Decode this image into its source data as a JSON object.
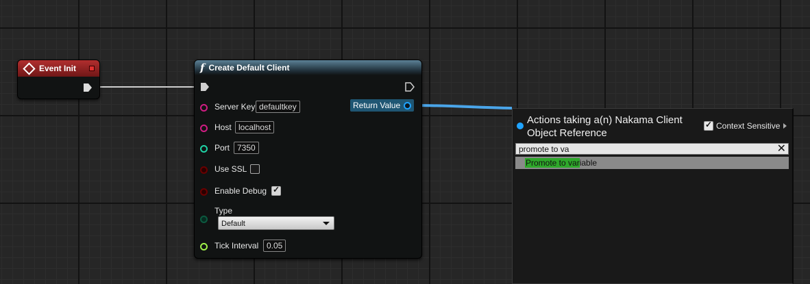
{
  "event_node": {
    "title": "Event Init"
  },
  "func_node": {
    "title": "Create Default Client",
    "glyph": "f",
    "return_label": "Return Value",
    "pins": {
      "server_key": {
        "label": "Server Key",
        "value": "defaultkey"
      },
      "host": {
        "label": "Host",
        "value": "localhost"
      },
      "port": {
        "label": "Port",
        "value": "7350"
      },
      "use_ssl": {
        "label": "Use SSL",
        "checked": false
      },
      "enable_debug": {
        "label": "Enable Debug",
        "checked": true
      },
      "type": {
        "label": "Type",
        "value": "Default"
      },
      "tick_interval": {
        "label": "Tick Interval",
        "value": "0.05"
      }
    }
  },
  "action_menu": {
    "title": "Actions taking a(n) Nakama Client Object Reference",
    "context_label": "Context Sensitive",
    "context_checked": true,
    "search_value": "promote to va",
    "results": [
      {
        "label": "Promote to variable"
      }
    ]
  },
  "colors": {
    "event_header": "#b12e2e",
    "func_header": "#5b8196",
    "object_pin": "#1fa3ff",
    "string_pin": "#d11d83",
    "int_pin": "#1fd4a6",
    "bool_pin": "#8c0000",
    "float_pin": "#a0f24a",
    "highlight": "#2ea82a"
  }
}
